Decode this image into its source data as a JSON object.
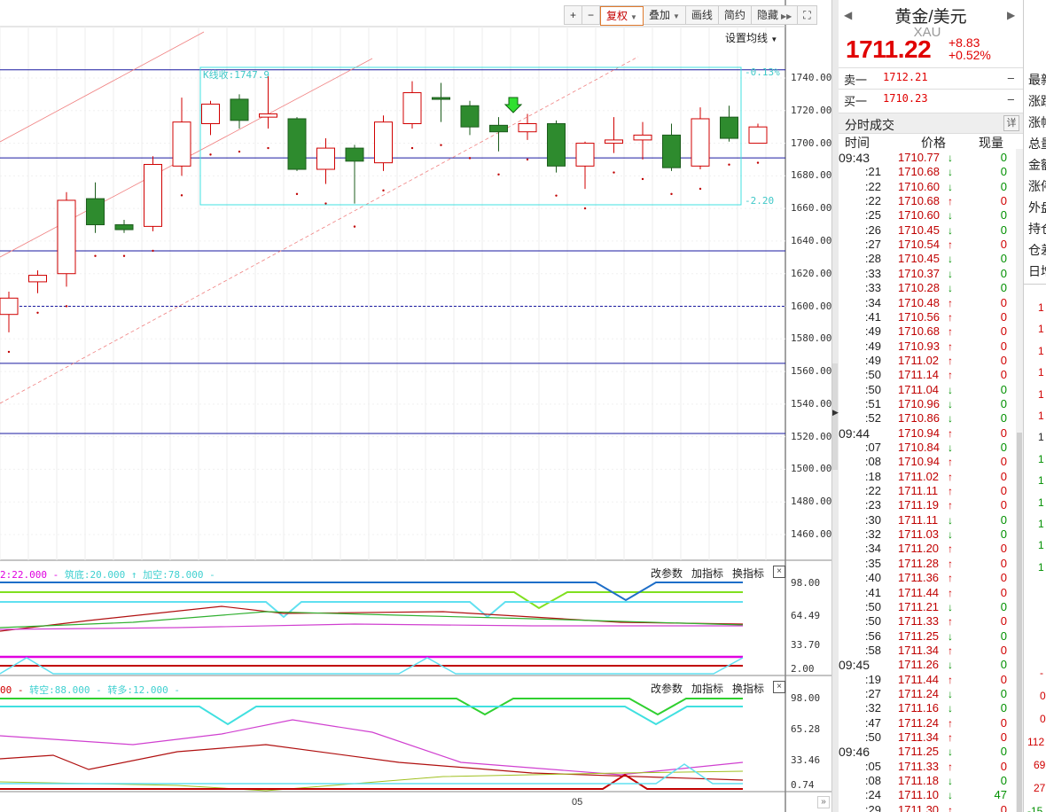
{
  "toolbar": {
    "zoom_in": "+",
    "zoom_out": "−",
    "restore_right": "复权",
    "overlay": "叠加",
    "draw_line": "画线",
    "simple": "简约",
    "hide": "隐藏"
  },
  "ma_setting": "设置均线",
  "y_axis_labels": [
    "1740.00",
    "1720.00",
    "1700.00",
    "1680.00",
    "1660.00",
    "1640.00",
    "1620.00",
    "1600.00",
    "1580.00",
    "1560.00",
    "1540.00",
    "1520.00",
    "1500.00",
    "1480.00",
    "1460.00"
  ],
  "box_annotations": {
    "top_pct": "-0.13%",
    "bottom": "-2.20",
    "kline_label": "K线收:1747.9"
  },
  "indicator1": {
    "legend": [
      {
        "text": "2:22.000 -",
        "color": "#e000e0"
      },
      {
        "text": "筑底:20.000 ↑",
        "color": "#40e0e0"
      },
      {
        "text": "加空:78.000 -",
        "color": "#40e0e0"
      }
    ],
    "buttons": [
      "改参数",
      "加指标",
      "换指标"
    ],
    "close": "×",
    "y_labels": [
      "98.00",
      "64.49",
      "33.70",
      "2.00"
    ]
  },
  "indicator2": {
    "legend": [
      {
        "text": "00 -",
        "color": "#d00000"
      },
      {
        "text": "转空:88.000 -",
        "color": "#40e0e0"
      },
      {
        "text": "转多:12.000 -",
        "color": "#40e0e0"
      }
    ],
    "buttons": [
      "改参数",
      "加指标",
      "换指标"
    ],
    "close": "×",
    "y_labels": [
      "98.00",
      "65.28",
      "33.46",
      "0.74"
    ]
  },
  "x_axis_label": "05",
  "quote": {
    "title": "黄金/美元",
    "code": "XAU",
    "price": "1711.22",
    "change": "+8.83",
    "change_pct": "+0.52%",
    "ask_label": "卖一",
    "ask_price": "1712.21",
    "ask_vol": "–",
    "bid_label": "买一",
    "bid_price": "1710.23",
    "bid_vol": "–",
    "tick_section": "分时成交",
    "detail_btn": "详",
    "col_time": "时间",
    "col_price": "价格",
    "col_vol": "现量"
  },
  "ticks": [
    {
      "t": "09:43",
      "p": "1710.77",
      "d": "down",
      "v": "0"
    },
    {
      "t": ":21",
      "p": "1710.68",
      "d": "down",
      "v": "0"
    },
    {
      "t": ":22",
      "p": "1710.60",
      "d": "down",
      "v": "0"
    },
    {
      "t": ":22",
      "p": "1710.68",
      "d": "up",
      "v": "0"
    },
    {
      "t": ":25",
      "p": "1710.60",
      "d": "down",
      "v": "0"
    },
    {
      "t": ":26",
      "p": "1710.45",
      "d": "down",
      "v": "0"
    },
    {
      "t": ":27",
      "p": "1710.54",
      "d": "up",
      "v": "0"
    },
    {
      "t": ":28",
      "p": "1710.45",
      "d": "down",
      "v": "0"
    },
    {
      "t": ":33",
      "p": "1710.37",
      "d": "down",
      "v": "0"
    },
    {
      "t": ":33",
      "p": "1710.28",
      "d": "down",
      "v": "0"
    },
    {
      "t": ":34",
      "p": "1710.48",
      "d": "up",
      "v": "0"
    },
    {
      "t": ":41",
      "p": "1710.56",
      "d": "up",
      "v": "0"
    },
    {
      "t": ":49",
      "p": "1710.68",
      "d": "up",
      "v": "0"
    },
    {
      "t": ":49",
      "p": "1710.93",
      "d": "up",
      "v": "0"
    },
    {
      "t": ":49",
      "p": "1711.02",
      "d": "up",
      "v": "0"
    },
    {
      "t": ":50",
      "p": "1711.14",
      "d": "up",
      "v": "0"
    },
    {
      "t": ":50",
      "p": "1711.04",
      "d": "down",
      "v": "0"
    },
    {
      "t": ":51",
      "p": "1710.96",
      "d": "down",
      "v": "0"
    },
    {
      "t": ":52",
      "p": "1710.86",
      "d": "down",
      "v": "0"
    },
    {
      "t": "09:44",
      "p": "1710.94",
      "d": "up",
      "v": "0"
    },
    {
      "t": ":07",
      "p": "1710.84",
      "d": "down",
      "v": "0"
    },
    {
      "t": ":08",
      "p": "1710.94",
      "d": "up",
      "v": "0"
    },
    {
      "t": ":18",
      "p": "1711.02",
      "d": "up",
      "v": "0"
    },
    {
      "t": ":22",
      "p": "1711.11",
      "d": "up",
      "v": "0"
    },
    {
      "t": ":23",
      "p": "1711.19",
      "d": "up",
      "v": "0"
    },
    {
      "t": ":30",
      "p": "1711.11",
      "d": "down",
      "v": "0"
    },
    {
      "t": ":32",
      "p": "1711.03",
      "d": "down",
      "v": "0"
    },
    {
      "t": ":34",
      "p": "1711.20",
      "d": "up",
      "v": "0"
    },
    {
      "t": ":35",
      "p": "1711.28",
      "d": "up",
      "v": "0"
    },
    {
      "t": ":40",
      "p": "1711.36",
      "d": "up",
      "v": "0"
    },
    {
      "t": ":41",
      "p": "1711.44",
      "d": "up",
      "v": "0"
    },
    {
      "t": ":50",
      "p": "1711.21",
      "d": "down",
      "v": "0"
    },
    {
      "t": ":50",
      "p": "1711.33",
      "d": "up",
      "v": "0"
    },
    {
      "t": ":56",
      "p": "1711.25",
      "d": "down",
      "v": "0"
    },
    {
      "t": ":58",
      "p": "1711.34",
      "d": "up",
      "v": "0"
    },
    {
      "t": "09:45",
      "p": "1711.26",
      "d": "down",
      "v": "0"
    },
    {
      "t": ":19",
      "p": "1711.44",
      "d": "up",
      "v": "0"
    },
    {
      "t": ":27",
      "p": "1711.24",
      "d": "down",
      "v": "0"
    },
    {
      "t": ":32",
      "p": "1711.16",
      "d": "down",
      "v": "0"
    },
    {
      "t": ":47",
      "p": "1711.24",
      "d": "up",
      "v": "0"
    },
    {
      "t": ":50",
      "p": "1711.34",
      "d": "up",
      "v": "0"
    },
    {
      "t": "09:46",
      "p": "1711.25",
      "d": "down",
      "v": "0"
    },
    {
      "t": ":05",
      "p": "1711.33",
      "d": "up",
      "v": "0"
    },
    {
      "t": ":08",
      "p": "1711.18",
      "d": "down",
      "v": "0"
    },
    {
      "t": ":24",
      "p": "1711.10",
      "d": "down",
      "v": "47"
    },
    {
      "t": ":29",
      "p": "1711.30",
      "d": "up",
      "v": "0"
    }
  ],
  "right_labels": [
    "最新",
    "涨跌",
    "涨幅",
    "总量",
    "金额",
    "涨停",
    "外盘",
    "持仓",
    "仓差",
    "日增"
  ],
  "right_numbers": [
    {
      "t": "1",
      "c": "#d00000"
    },
    {
      "t": "1",
      "c": "#d00000"
    },
    {
      "t": "1",
      "c": "#d00000"
    },
    {
      "t": "1",
      "c": "#d00000"
    },
    {
      "t": "1",
      "c": "#d00000"
    },
    {
      "t": "1",
      "c": "#d00000"
    },
    {
      "t": "1",
      "c": "#222222"
    },
    {
      "t": "1",
      "c": "#009000"
    },
    {
      "t": "1",
      "c": "#009000"
    },
    {
      "t": "1",
      "c": "#009000"
    },
    {
      "t": "1",
      "c": "#009000"
    },
    {
      "t": "1",
      "c": "#009000"
    },
    {
      "t": "1",
      "c": "#009000"
    }
  ],
  "right_bottom": [
    {
      "t": "-",
      "c": "#d00000"
    },
    {
      "t": "0",
      "c": "#d00000"
    },
    {
      "t": "0",
      "c": "#d00000"
    },
    {
      "t": "112",
      "c": "#d00000"
    },
    {
      "t": "69",
      "c": "#d00000"
    },
    {
      "t": "27",
      "c": "#d00000"
    },
    {
      "t": "-15",
      "c": "#009000"
    }
  ],
  "candles": [
    {
      "o": 1595,
      "h": 1609,
      "l": 1584,
      "c": 1605
    },
    {
      "o": 1615,
      "h": 1622,
      "l": 1608,
      "c": 1619
    },
    {
      "o": 1620,
      "h": 1670,
      "l": 1612,
      "c": 1665
    },
    {
      "o": 1666,
      "h": 1676,
      "l": 1645,
      "c": 1650
    },
    {
      "o": 1650,
      "h": 1653,
      "l": 1645,
      "c": 1647
    },
    {
      "o": 1649,
      "h": 1692,
      "l": 1646,
      "c": 1687
    },
    {
      "o": 1686,
      "h": 1728,
      "l": 1680,
      "c": 1713
    },
    {
      "o": 1712,
      "h": 1726,
      "l": 1705,
      "c": 1724
    },
    {
      "o": 1727,
      "h": 1730,
      "l": 1709,
      "c": 1714
    },
    {
      "o": 1716,
      "h": 1741,
      "l": 1709,
      "c": 1718
    },
    {
      "o": 1715,
      "h": 1716,
      "l": 1683,
      "c": 1684
    },
    {
      "o": 1684,
      "h": 1703,
      "l": 1675,
      "c": 1697
    },
    {
      "o": 1697,
      "h": 1699,
      "l": 1663,
      "c": 1689
    },
    {
      "o": 1688,
      "h": 1717,
      "l": 1683,
      "c": 1713
    },
    {
      "o": 1712,
      "h": 1738,
      "l": 1709,
      "c": 1731
    },
    {
      "o": 1728,
      "h": 1737,
      "l": 1713,
      "c": 1727
    },
    {
      "o": 1723,
      "h": 1726,
      "l": 1705,
      "c": 1710
    },
    {
      "o": 1711,
      "h": 1716,
      "l": 1695,
      "c": 1707
    },
    {
      "o": 1707,
      "h": 1718,
      "l": 1702,
      "c": 1712
    },
    {
      "o": 1712,
      "h": 1714,
      "l": 1682,
      "c": 1686
    },
    {
      "o": 1686,
      "h": 1701,
      "l": 1672,
      "c": 1700
    },
    {
      "o": 1700,
      "h": 1716,
      "l": 1694,
      "c": 1702
    },
    {
      "o": 1702,
      "h": 1713,
      "l": 1690,
      "c": 1705
    },
    {
      "o": 1705,
      "h": 1712,
      "l": 1683,
      "c": 1685
    },
    {
      "o": 1686,
      "h": 1722,
      "l": 1684,
      "c": 1715
    },
    {
      "o": 1716,
      "h": 1723,
      "l": 1701,
      "c": 1703
    },
    {
      "o": 1700,
      "h": 1712,
      "l": 1700,
      "c": 1710
    }
  ],
  "colors": {
    "up": "#d00000",
    "down": "#2e8b2e",
    "grid": "#1a1aa0",
    "box": "#40e0e0",
    "trend": "#f08080"
  }
}
